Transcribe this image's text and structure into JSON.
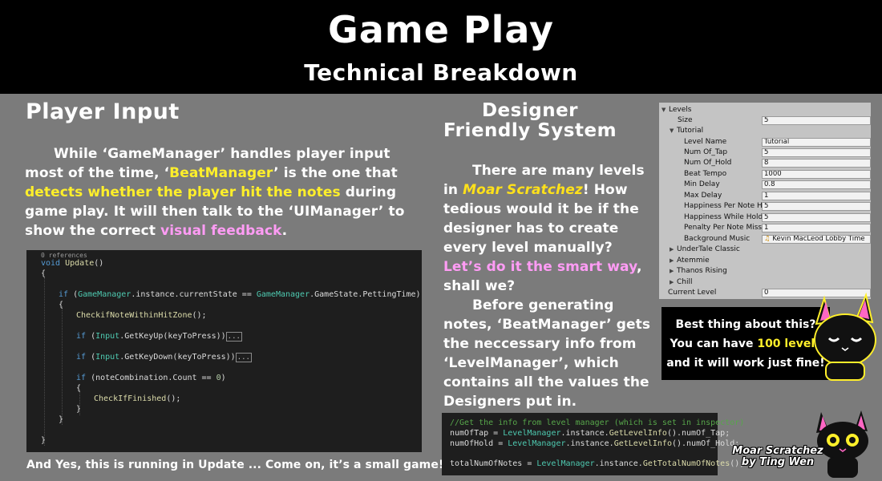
{
  "header": {
    "title": "Game Play",
    "subtitle": "Technical Breakdown"
  },
  "left": {
    "heading": "Player Input",
    "para": {
      "t1": "While ‘GameManager’ handles player input most of the time, ‘",
      "h1": "BeatManager",
      "t2": "’ is the one that ",
      "h2": "detects whether the player hit the notes",
      "t3": " during game play. It will then talk to the ‘UIManager’ to show the correct ",
      "h3": "visual feedback",
      "t4": "."
    },
    "footer": "And Yes, this is running in Update ... Come on, it’s a small game! :p"
  },
  "code1": {
    "refs": "0 references",
    "l_void": "void",
    "l_update": "Update",
    "l_update_tail": "()",
    "brace_open": "{",
    "brace_close": "}",
    "if": "if",
    "gm": "GameManager",
    "cond_mid": ".instance.currentState == ",
    "gm2": "GameManager",
    "cond_tail": ".GameState.PettingTime)",
    "paren_open": " (",
    "check_hit": "CheckifNoteWithinHitZone",
    "check_hit_tail": "();",
    "input": "Input",
    "getkeyup": ".GetKeyUp(keyToPress))",
    "getkeydown": ".GetKeyDown(keyToPress))",
    "fold": "...",
    "note_comb": " (noteCombination.Count == ",
    "zero": "0",
    "note_tail": ")",
    "check_fin": "CheckIfFinished",
    "check_fin_tail": "();"
  },
  "mid": {
    "heading": "Designer Friendly System",
    "para1": {
      "t1": "There are many levels in ",
      "moar": "Moar Scratchez",
      "t2": "! How tedious would it be if the designer has to create every level manually? ",
      "h1": "Let’s do it the smart way",
      "t3": ", shall we?"
    },
    "para2": "Before generating notes, ‘BeatManager’ gets the neccessary info from ‘LevelManager’, which contains all the values the Designers put in."
  },
  "code2": {
    "comment": "//Get the info from level manager (which is set in inspector)",
    "l1_a": "numOfTap = ",
    "lm": "LevelManager",
    "l1_b": ".instance.",
    "getinfo": "GetLevelInfo",
    "l1_c": "().numOf_Tap;",
    "l2_a": "numOfHold = ",
    "l2_c": "().numOf_Hold;",
    "l3_a": "totalNumOfNotes = ",
    "gettotal": "GetTotalNumOfNotes",
    "l3_c": "();"
  },
  "inspector": {
    "levels": "Levels",
    "size_label": "Size",
    "size_value": "5",
    "tutorial": "Tutorial",
    "fields": [
      {
        "label": "Level Name",
        "value": "Tutorial"
      },
      {
        "label": "Num Of_Tap",
        "value": "5"
      },
      {
        "label": "Num Of_Hold",
        "value": "8"
      },
      {
        "label": "Beat Tempo",
        "value": "1000"
      },
      {
        "label": "Min Delay",
        "value": "0.8"
      },
      {
        "label": "Max Delay",
        "value": "1"
      },
      {
        "label": "Happiness Per Note Hit",
        "value": "5"
      },
      {
        "label": "Happiness While Hold",
        "value": "5"
      },
      {
        "label": "Penalty Per Note Miss",
        "value": "1"
      },
      {
        "label": "Background Music",
        "value": "Kevin MacLeod Lobby Time"
      }
    ],
    "collapsed": [
      "UnderTale Classic",
      "Atemmie",
      "Thanos Rising",
      "Chill"
    ],
    "current_label": "Current Level",
    "current_value": "0"
  },
  "best": {
    "l1": "Best thing about this?",
    "l2a": "You can have ",
    "l2b": "100 levels",
    "l3": "and it will work just fine!"
  },
  "credit": {
    "l1": "Moar Scratchez",
    "l2": "by Ting Wen"
  }
}
